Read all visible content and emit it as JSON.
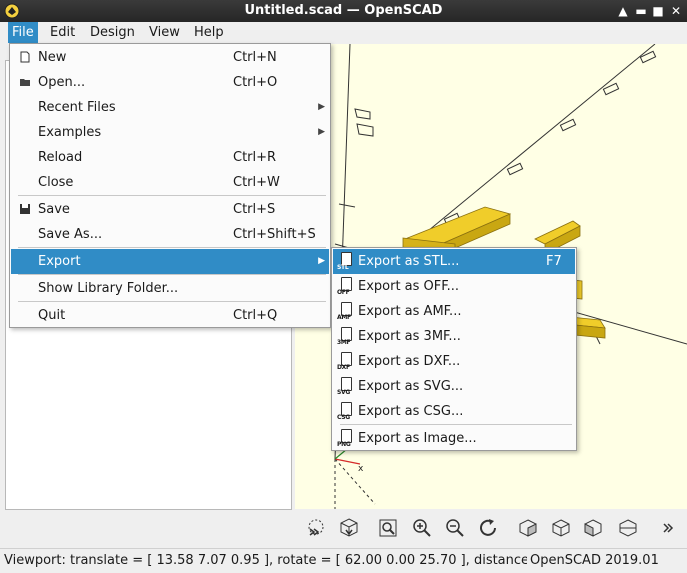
{
  "window": {
    "title": "Untitled.scad — OpenSCAD",
    "controls": [
      "▲",
      "▬",
      "■",
      "✕"
    ]
  },
  "menubar": [
    {
      "label": "File",
      "active": true
    },
    {
      "label": "Edit",
      "active": false
    },
    {
      "label": "Design",
      "active": false
    },
    {
      "label": "View",
      "active": false
    },
    {
      "label": "Help",
      "active": false
    }
  ],
  "file_menu": {
    "items": [
      {
        "label": "New",
        "shortcut": "Ctrl+N",
        "icon": "new-file-icon"
      },
      {
        "label": "Open...",
        "shortcut": "Ctrl+O",
        "icon": "folder-icon"
      },
      {
        "label": "Recent Files",
        "shortcut": "",
        "submenu": true
      },
      {
        "label": "Examples",
        "shortcut": "",
        "submenu": true
      },
      {
        "label": "Reload",
        "shortcut": "Ctrl+R"
      },
      {
        "label": "Close",
        "shortcut": "Ctrl+W"
      },
      {
        "label": "Save",
        "shortcut": "Ctrl+S",
        "icon": "save-icon"
      },
      {
        "label": "Save As...",
        "shortcut": "Ctrl+Shift+S"
      },
      {
        "label": "Export",
        "shortcut": "",
        "submenu": true,
        "highlighted": true
      },
      {
        "label": "Show Library Folder...",
        "shortcut": ""
      },
      {
        "label": "Quit",
        "shortcut": "Ctrl+Q"
      }
    ]
  },
  "export_menu": {
    "items": [
      {
        "label": "Export as STL...",
        "shortcut": "F7",
        "tag": "STL",
        "highlighted": true
      },
      {
        "label": "Export as OFF...",
        "shortcut": "",
        "tag": "OFF"
      },
      {
        "label": "Export as AMF...",
        "shortcut": "",
        "tag": "AMF"
      },
      {
        "label": "Export as 3MF...",
        "shortcut": "",
        "tag": "3MF"
      },
      {
        "label": "Export as DXF...",
        "shortcut": "",
        "tag": "DXF"
      },
      {
        "label": "Export as SVG...",
        "shortcut": "",
        "tag": "SVG"
      },
      {
        "label": "Export as CSG...",
        "shortcut": "",
        "tag": "CSG"
      },
      {
        "label": "Export as Image...",
        "shortcut": "",
        "tag": "PNG"
      }
    ]
  },
  "toolbar": {
    "icons": [
      "preview-icon",
      "render-icon",
      "view-all-icon",
      "zoom-in-icon",
      "zoom-out-icon",
      "reset-view-icon",
      "view-right-icon",
      "view-top-icon",
      "view-bottom-icon",
      "view-left-icon",
      "more-icon"
    ]
  },
  "statusbar": {
    "viewport": "Viewport: translate = [ 13.58 7.07 0.95 ], rotate = [ 62.00 0.00 25.70 ], distance",
    "version": "OpenSCAD 2019.01"
  },
  "colors": {
    "accent": "#308cc6",
    "model": "#f0cd2a",
    "viewport_bg": "#ffffe5",
    "axis_x": "#d42a2a"
  }
}
